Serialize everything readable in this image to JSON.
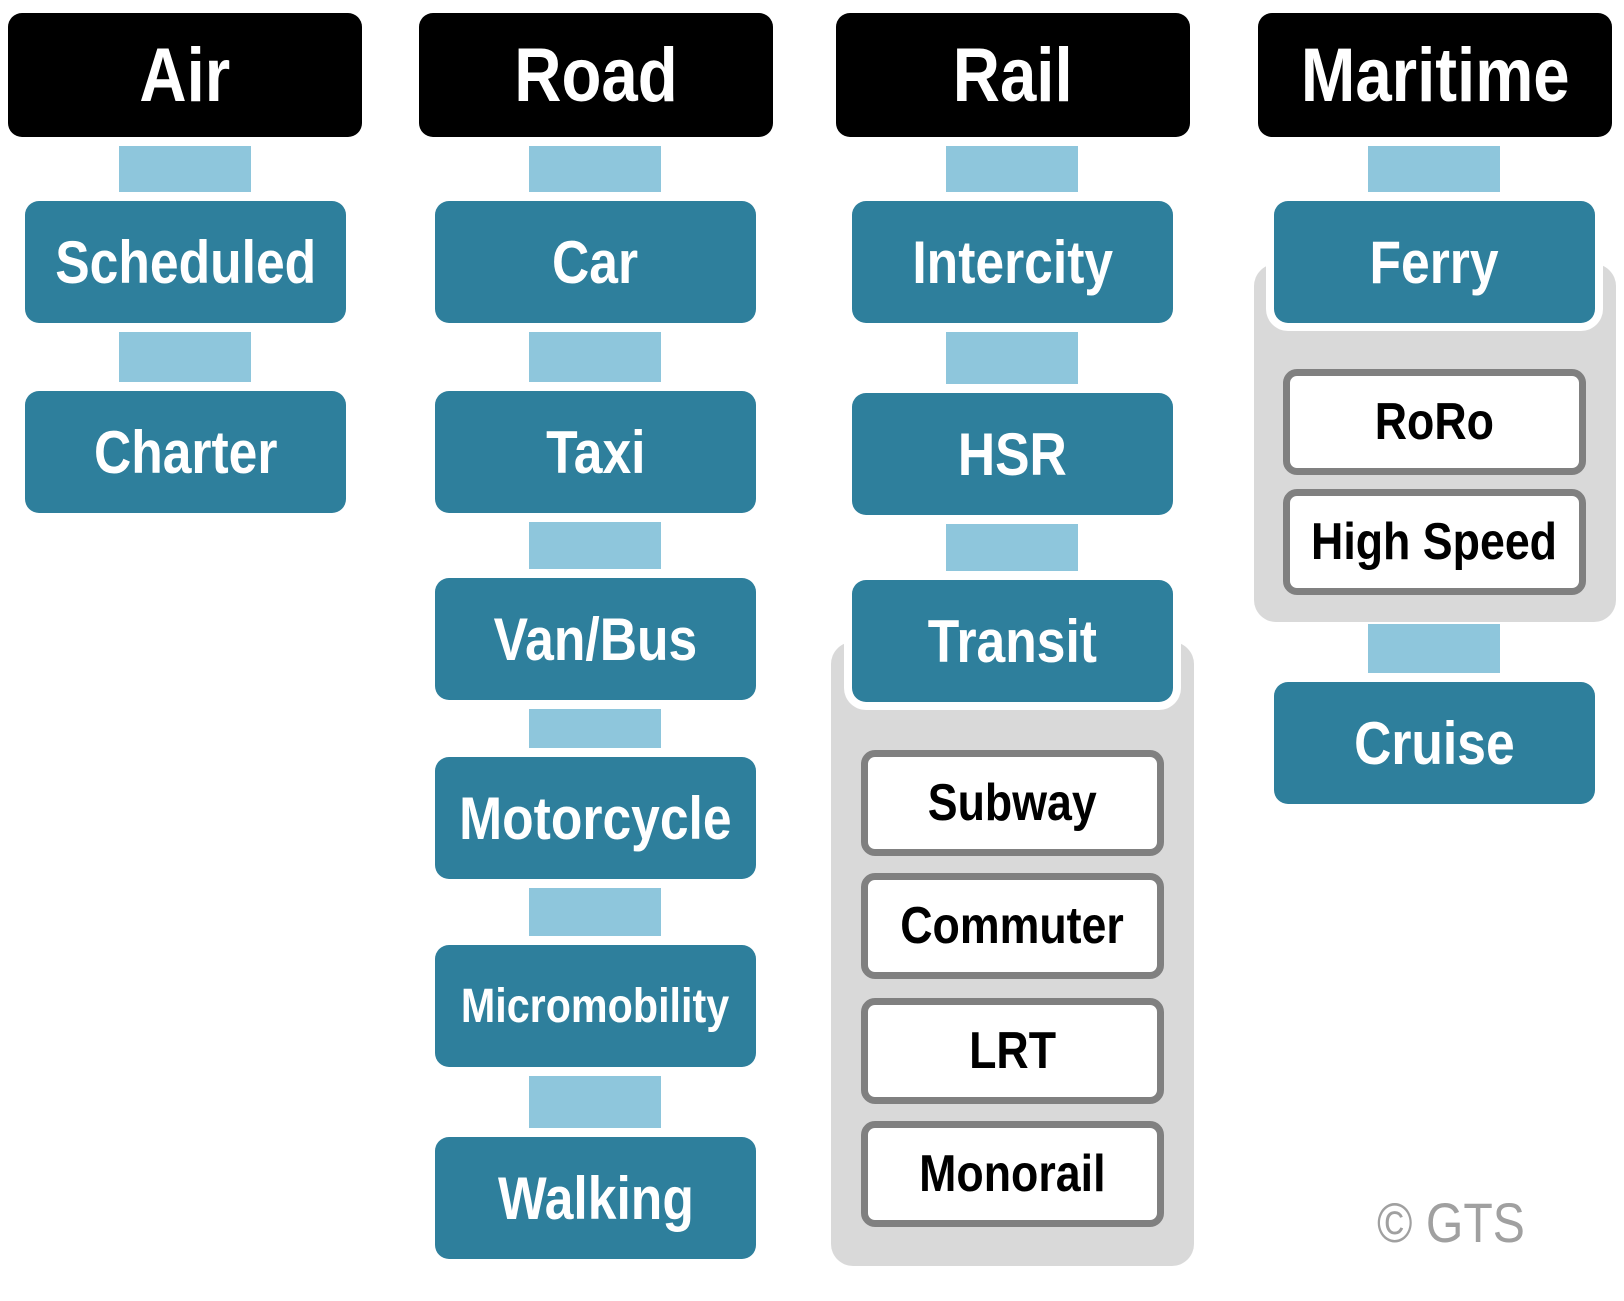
{
  "colors": {
    "header": "#000000",
    "mode_box": "#2E7F9C",
    "connector": "#8EC6DC",
    "group_panel": "#D9D9D9",
    "sub_border": "#808080"
  },
  "columns": [
    {
      "title": "Air",
      "items": [
        "Scheduled",
        "Charter"
      ]
    },
    {
      "title": "Road",
      "items": [
        "Car",
        "Taxi",
        "Van/Bus",
        "Motorcycle",
        "Micromobility",
        "Walking"
      ]
    },
    {
      "title": "Rail",
      "items": [
        "Intercity",
        "HSR",
        "Transit"
      ],
      "transit_subtypes": [
        "Subway",
        "Commuter",
        "LRT",
        "Monorail"
      ]
    },
    {
      "title": "Maritime",
      "items": [
        "Ferry",
        "Cruise"
      ],
      "ferry_subtypes": [
        "RoRo",
        "High Speed"
      ]
    }
  ],
  "copyright": "© GTS"
}
